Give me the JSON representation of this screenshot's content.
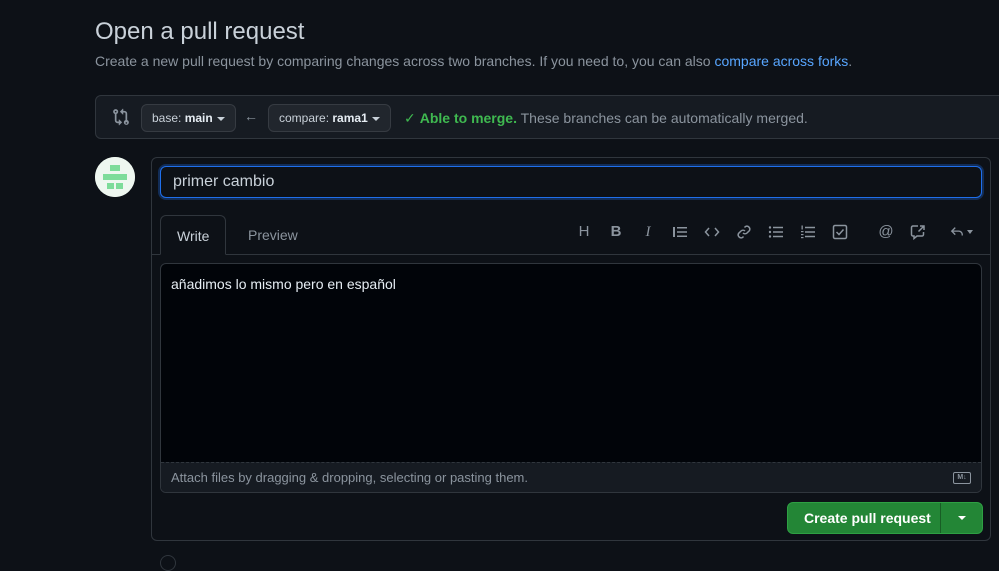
{
  "header": {
    "title": "Open a pull request",
    "subtitle_prefix": "Create a new pull request by comparing changes across two branches. If you need to, you can also ",
    "subtitle_link": "compare across forks",
    "subtitle_suffix": "."
  },
  "range": {
    "base_label": "base:",
    "base_branch": "main",
    "compare_label": "compare:",
    "compare_branch": "rama1",
    "merge_ok": "Able to merge.",
    "merge_text": " These branches can be automatically merged."
  },
  "form": {
    "title_value": "primer cambio",
    "tabs": [
      "Write",
      "Preview"
    ],
    "body_text": "añadimos lo mismo pero en español",
    "attach_text": "Attach files by dragging & dropping, selecting or pasting them.",
    "toolbar_icons": [
      "heading-icon",
      "bold-icon",
      "italic-icon",
      "quote-icon",
      "code-icon",
      "link-icon",
      "unordered-list-icon",
      "ordered-list-icon",
      "task-list-icon",
      "mention-icon",
      "cross-reference-icon",
      "reply-icon"
    ],
    "submit_label": "Create pull request"
  },
  "colors": {
    "accent": "#58a6ff",
    "success": "#3fb950",
    "button": "#238636",
    "background": "#0d1117"
  }
}
